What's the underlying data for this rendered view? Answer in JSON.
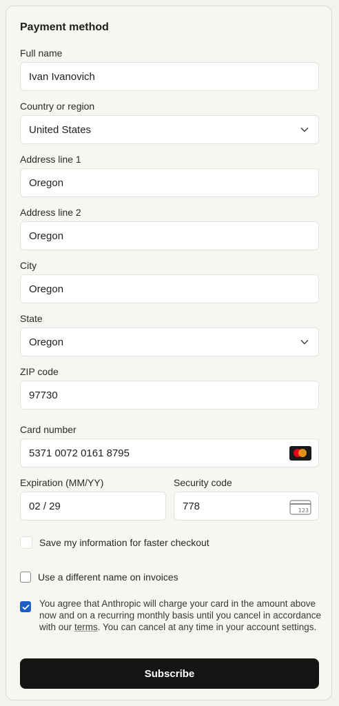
{
  "payment": {
    "title": "Payment method",
    "full_name": {
      "label": "Full name",
      "value": "Ivan Ivanovich"
    },
    "country": {
      "label": "Country or region",
      "value": "United States"
    },
    "address1": {
      "label": "Address line 1",
      "value": "Oregon"
    },
    "address2": {
      "label": "Address line 2",
      "value": "Oregon"
    },
    "city": {
      "label": "City",
      "value": "Oregon"
    },
    "state": {
      "label": "State",
      "value": "Oregon"
    },
    "zip": {
      "label": "ZIP code",
      "value": "97730"
    },
    "card_number": {
      "label": "Card number",
      "value": "5371 0072 0161 8795",
      "brand_icon": "mastercard-icon"
    },
    "expiration": {
      "label": "Expiration (MM/YY)",
      "value": "02 / 29"
    },
    "security_code": {
      "label": "Security code",
      "value": "778",
      "icon_text": "123"
    },
    "save_info": {
      "label": "Save my information for faster checkout",
      "checked": false
    },
    "different_name": {
      "label": "Use a different name on invoices",
      "checked": false
    },
    "agreement": {
      "checked": true,
      "text_before": "You agree that Anthropic will charge your card in the amount above now and on a recurring monthly basis until you cancel in accordance with our ",
      "terms_link": "terms",
      "text_after": ". You can cancel at any time in your account settings."
    },
    "subscribe_label": "Subscribe"
  },
  "colors": {
    "background": "#f3f2ee",
    "panel": "#f7f6f2",
    "button": "#141413",
    "checkbox_checked": "#1d5fc4"
  }
}
